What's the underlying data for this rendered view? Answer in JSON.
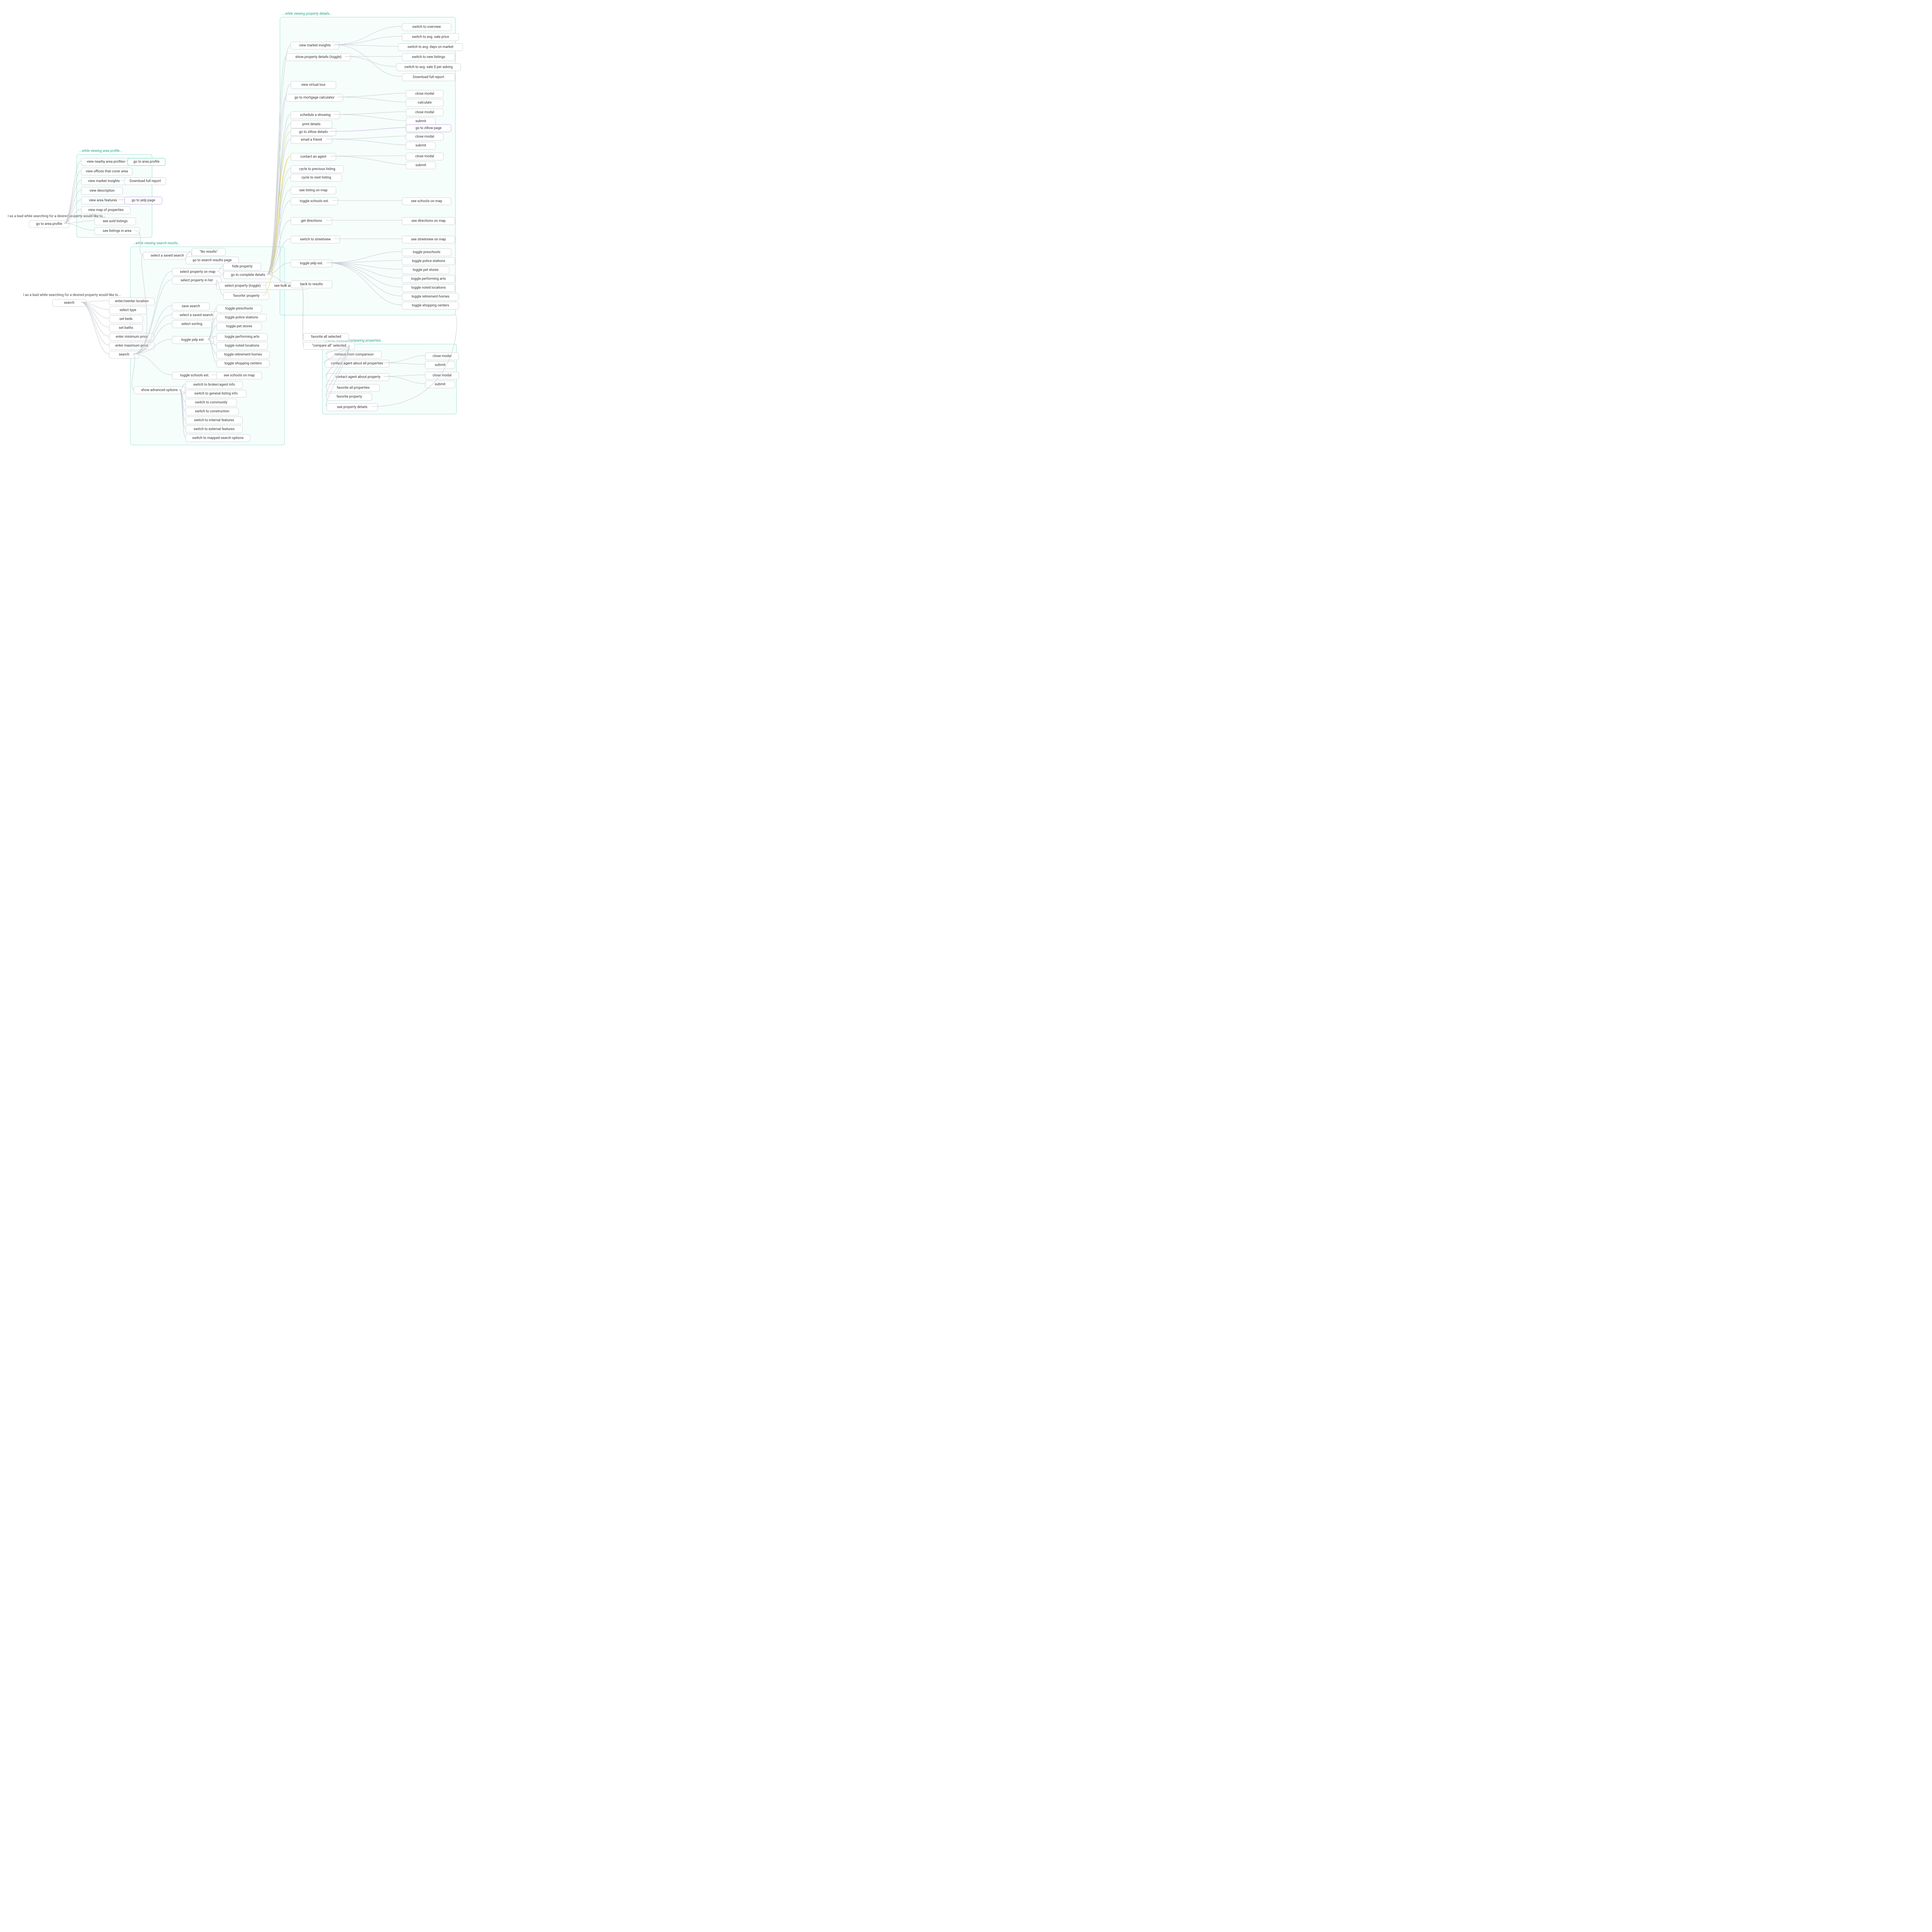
{
  "statements": {
    "area_profile": "I as a lead while searching for a desired property would like to...",
    "search": "I as a lead while searching for a desired property would like to..."
  },
  "root_actions": {
    "go_area_profile": "go to area profile",
    "search": "search"
  },
  "regions": {
    "area_profile": "...while viewing area profile...",
    "search_results": "...while viewing search results...",
    "property_details": "...while viewing property details...",
    "comparing": "...while viewing comparing properties..."
  },
  "area_profile": {
    "nearby": "view nearby area profiles",
    "nearby_go": "go to area profile",
    "offices": "view offices that cover area",
    "insights": "view market insights",
    "insights_dl": "Download full report",
    "description": "view description",
    "features": "view area features",
    "features_yelp": "go to yelp page",
    "map_props": "view map of properties",
    "sold": "see sold listings",
    "listings": "see listings in area"
  },
  "search_inputs": {
    "location": "enter/reenter location",
    "type": "select type",
    "beds": "set beds",
    "baths": "set baths",
    "min_price": "enter minimum price",
    "max_price": "enter maximum price",
    "search_btn": "search"
  },
  "search_results": {
    "select_saved": "select a saved search",
    "no_results": "\"No results\"",
    "go_results": "go to search results page",
    "prop_on_map": "select property on map",
    "prop_in_list": "select property in list",
    "hide": "hide property",
    "go_details": "go to complete details",
    "prop_toggle": "select property (toggle)",
    "bulk": "see bulk actions",
    "favorite": "'favorite' property",
    "save_search": "save search",
    "select_saved2": "select a saved search",
    "sorting": "select sorting",
    "yelp_ext": "toggle yelp ext.",
    "yelp_preschools": "toggle preschools",
    "yelp_police": "toggle police stations",
    "yelp_pet": "toggle pet stores",
    "yelp_arts": "toggle performing arts",
    "yelp_noted": "toggle noted locations",
    "yelp_retire": "toggle retirement homes",
    "yelp_shop": "toggle shopping centers",
    "schools_ext": "toggle schools ext.",
    "schools_map": "see schools on map",
    "advanced": "show advanced options",
    "adv_broker": "switch to broker/agent info",
    "adv_listing": "switch to general listing info",
    "adv_community": "switch to community",
    "adv_construction": "switch to construction",
    "adv_internal": "switch to internal features",
    "adv_external": "switch to external features",
    "adv_mapped": "switch to mapped search options"
  },
  "bulk": {
    "fav_all": "favorite all selected",
    "compare_all": "\"compare all\" selected"
  },
  "property_details": {
    "market_insights": "view market insights",
    "mi_overview": "switch to overview",
    "mi_avg_price": "switch to avg. sale price",
    "mi_avg_days": "switch to avg. days on market",
    "mi_new": "switch to new listings",
    "mi_avg_ask": "switch to avg. sale $ per asking",
    "mi_download": "Download full report",
    "show_details": "show property details (toggle)",
    "virtual_tour": "view virtual tour",
    "mortgage": "go to mortgage calculator",
    "mort_close": "close modal",
    "mort_calc": "calculate",
    "showing": "schedule a showing",
    "show_close": "close modal",
    "show_submit": "submit",
    "print": "print details",
    "zillow": "go to zillow details",
    "zillow_page": "go to zillow page",
    "email": "email a friend",
    "email_close": "close modal",
    "email_submit": "submit",
    "contact": "contact an agent",
    "contact_close": "close modal",
    "contact_submit": "submit",
    "prev": "cycle to previous listing",
    "next": "cycle to next listing",
    "see_map": "see listing on map",
    "schools_ext": "toggle schools ext.",
    "schools_map": "see schools on map",
    "directions": "get directions",
    "directions_map": "see directions on map",
    "streetview": "switch to streetview",
    "streetview_map": "see streetview on map",
    "yelp_ext": "toggle yelp ext.",
    "yelp_preschools": "toggle preschools",
    "yelp_police": "toggle police stations",
    "yelp_pet": "toggle pet stores",
    "yelp_arts": "toggle performing arts",
    "yelp_noted": "toggle noted locations",
    "yelp_retire": "toggle retirement homes",
    "yelp_shop": "toggle shopping centers",
    "back": "back to results"
  },
  "comparing": {
    "remove": "remove from comparison",
    "contact_all": "contact agent about all properties",
    "contact_all_close": "close modal",
    "contact_all_submit": "submit",
    "contact_one": "contact agent about property",
    "contact_one_close": "close modal",
    "contact_one_submit": "submit",
    "fav_all": "favorite all properties",
    "fav_one": "favorite property",
    "see_details": "see property details"
  }
}
